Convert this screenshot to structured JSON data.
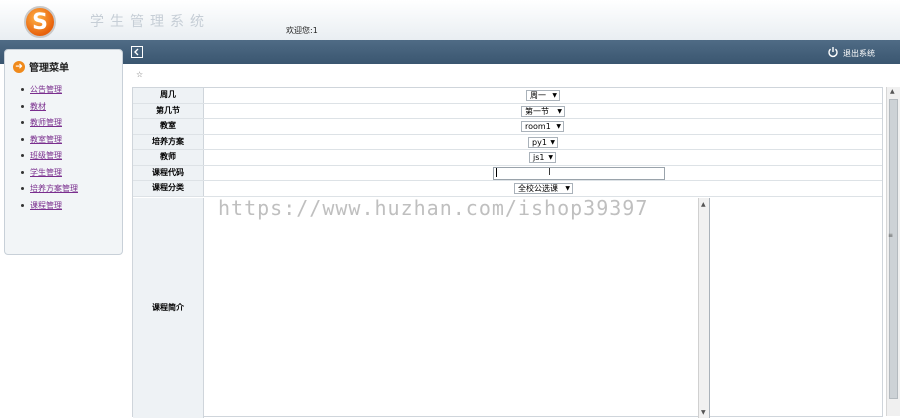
{
  "header": {
    "system_title": "学生管理系统",
    "welcome": "欢迎您:1",
    "logo_letter": "S"
  },
  "toolbar": {
    "logout_label": "退出系统",
    "toggle_icon": "collapse-icon",
    "logout_icon": "power-icon"
  },
  "sidebar": {
    "title": "管理菜单",
    "items": [
      {
        "label": "公告管理"
      },
      {
        "label": "教材"
      },
      {
        "label": "教师管理"
      },
      {
        "label": "教室管理"
      },
      {
        "label": "班级管理"
      },
      {
        "label": "学生管理"
      },
      {
        "label": "培养方案管理"
      },
      {
        "label": "课程管理"
      }
    ]
  },
  "breadcrumb": "☆",
  "form": {
    "weekday": {
      "label": "周几",
      "value": "周一"
    },
    "period": {
      "label": "第几节",
      "value": "第一节"
    },
    "classroom": {
      "label": "教室",
      "value": "room1"
    },
    "plan": {
      "label": "培养方案",
      "value": "py1"
    },
    "teacher": {
      "label": "教师",
      "value": "js1"
    },
    "course_code": {
      "label": "课程代码",
      "value": ""
    },
    "course_category": {
      "label": "课程分类",
      "value": "全校公选课"
    },
    "course_intro": {
      "label": "课程简介",
      "value": ""
    }
  },
  "watermark": "https://www.huzhan.com/ishop39397",
  "colors": {
    "toolbar_bg": "#3f5b75",
    "link": "#7a2e8e",
    "accent": "#f08a1c"
  }
}
